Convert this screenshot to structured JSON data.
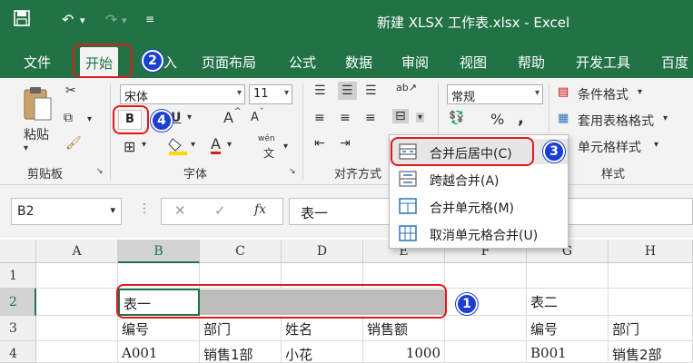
{
  "window": {
    "title": "新建 XLSX 工作表.xlsx  -  Excel",
    "accent": "#217346"
  },
  "tabs": [
    {
      "label": "文件"
    },
    {
      "label": "开始"
    },
    {
      "label": "入"
    },
    {
      "label": "页面布局"
    },
    {
      "label": "公式"
    },
    {
      "label": "数据"
    },
    {
      "label": "审阅"
    },
    {
      "label": "视图"
    },
    {
      "label": "帮助"
    },
    {
      "label": "开发工具"
    },
    {
      "label": "百度"
    }
  ],
  "ribbon": {
    "clipboard": {
      "paste": "粘贴",
      "group": "剪贴板"
    },
    "font": {
      "name": "宋体",
      "size": "11",
      "bold": "B",
      "underline": "U",
      "grow": "A",
      "shrink": "A",
      "color": "A",
      "wen": "wén",
      "group": "字体"
    },
    "alignment": {
      "group": "对齐方式"
    },
    "number": {
      "format": "常规",
      "percent": "%",
      "comma": ",",
      "group": "数字"
    },
    "styles": {
      "conditional": "条件格式",
      "table": "套用表格格式",
      "cell": "单元格样式",
      "group": "样式"
    }
  },
  "formula_bar": {
    "name_box": "B2",
    "cancel": "✕",
    "enter": "✓",
    "fx": "fx",
    "content": "表一"
  },
  "merge_menu": [
    {
      "label": "合并后居中(C)"
    },
    {
      "label": "跨越合并(A)"
    },
    {
      "label": "合并单元格(M)"
    },
    {
      "label": "取消单元格合并(U)"
    }
  ],
  "grid": {
    "columns": [
      "A",
      "B",
      "C",
      "D",
      "E",
      "F",
      "G",
      "H"
    ],
    "rows": [
      "1",
      "2",
      "3",
      "4"
    ],
    "cells": {
      "B2": "表一",
      "G2": "表二",
      "B3": "编号",
      "C3": "部门",
      "D3": "姓名",
      "E3": "销售额",
      "G3": "编号",
      "H3": "部门",
      "B4": "A001",
      "C4": "销售1部",
      "D4": "小花",
      "E4": "1000",
      "G4": "B001",
      "H4": "销售2部"
    }
  },
  "badges": [
    "1",
    "2",
    "3",
    "4"
  ]
}
